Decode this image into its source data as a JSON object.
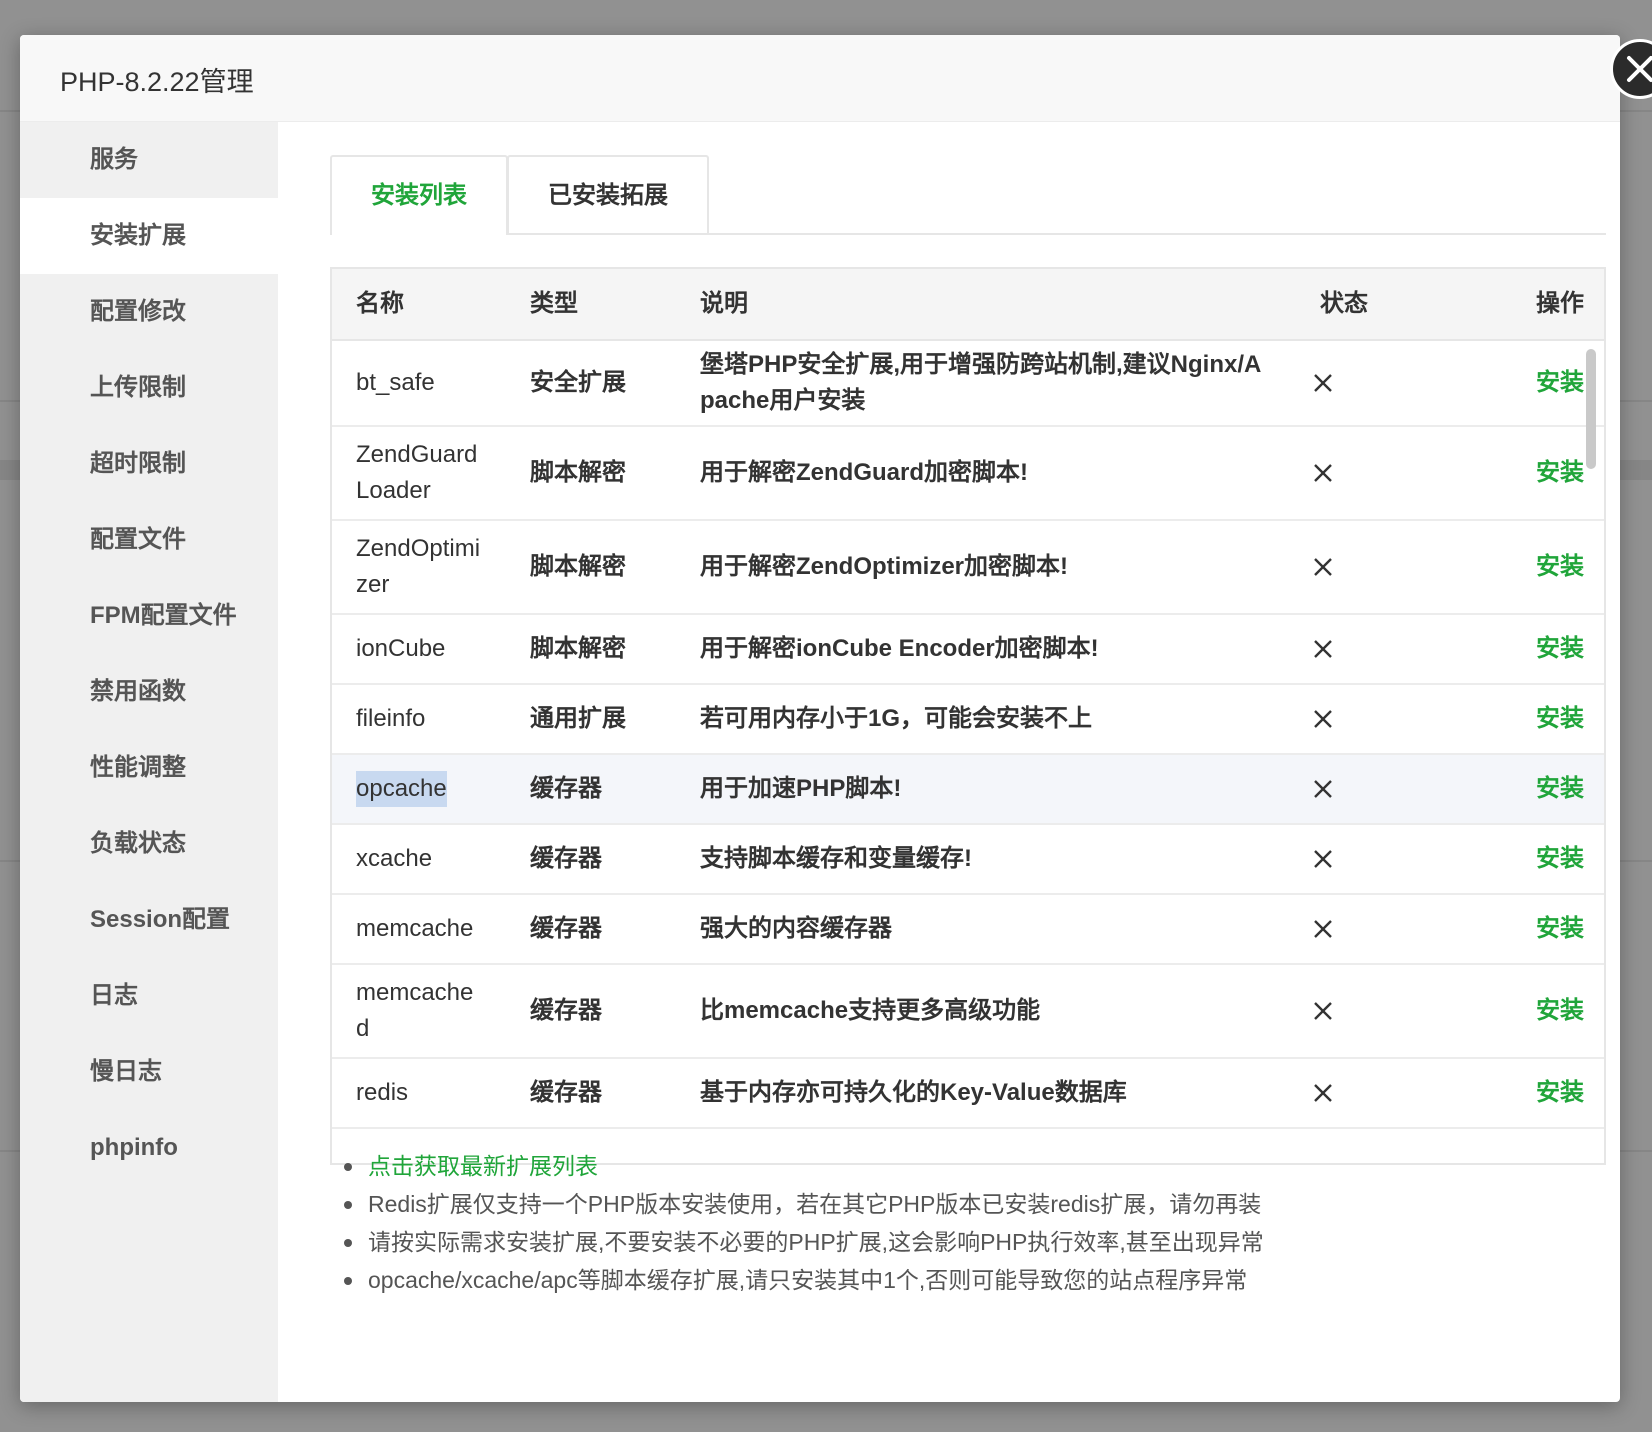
{
  "window": {
    "title": "PHP-8.2.22管理"
  },
  "close_icon": "close-circle-icon",
  "sidebar": {
    "items": [
      {
        "label": "服务",
        "active": false
      },
      {
        "label": "安装扩展",
        "active": true
      },
      {
        "label": "配置修改",
        "active": false
      },
      {
        "label": "上传限制",
        "active": false
      },
      {
        "label": "超时限制",
        "active": false
      },
      {
        "label": "配置文件",
        "active": false
      },
      {
        "label": "FPM配置文件",
        "active": false
      },
      {
        "label": "禁用函数",
        "active": false
      },
      {
        "label": "性能调整",
        "active": false
      },
      {
        "label": "负载状态",
        "active": false
      },
      {
        "label": "Session配置",
        "active": false
      },
      {
        "label": "日志",
        "active": false
      },
      {
        "label": "慢日志",
        "active": false
      },
      {
        "label": "phpinfo",
        "active": false
      }
    ]
  },
  "tabs": [
    {
      "label": "安装列表",
      "active": true
    },
    {
      "label": "已安装拓展",
      "active": false
    }
  ],
  "table": {
    "headers": {
      "name": "名称",
      "type": "类型",
      "desc": "说明",
      "status": "状态",
      "op": "操作"
    },
    "rows": [
      {
        "name": "bt_safe",
        "type": "安全扩展",
        "desc": "堡塔PHP安全扩展,用于增强防跨站机制,建议Nginx/Apache用户安装",
        "status": "✕",
        "op": "安装"
      },
      {
        "name": "ZendGuardLoader",
        "type": "脚本解密",
        "desc": "用于解密ZendGuard加密脚本!",
        "status": "✕",
        "op": "安装"
      },
      {
        "name": "ZendOptimizer",
        "type": "脚本解密",
        "desc": "用于解密ZendOptimizer加密脚本!",
        "status": "✕",
        "op": "安装"
      },
      {
        "name": "ionCube",
        "type": "脚本解密",
        "desc": "用于解密ionCube Encoder加密脚本!",
        "status": "✕",
        "op": "安装"
      },
      {
        "name": "fileinfo",
        "type": "通用扩展",
        "desc": "若可用内存小于1G，可能会安装不上",
        "status": "✕",
        "op": "安装"
      },
      {
        "name": "opcache",
        "type": "缓存器",
        "desc": "用于加速PHP脚本!",
        "status": "✕",
        "op": "安装"
      },
      {
        "name": "xcache",
        "type": "缓存器",
        "desc": "支持脚本缓存和变量缓存!",
        "status": "✕",
        "op": "安装"
      },
      {
        "name": "memcache",
        "type": "缓存器",
        "desc": "强大的内容缓存器",
        "status": "✕",
        "op": "安装"
      },
      {
        "name": "memcached",
        "type": "缓存器",
        "desc": "比memcache支持更多高级功能",
        "status": "✕",
        "op": "安装"
      },
      {
        "name": "redis",
        "type": "缓存器",
        "desc": "基于内存亦可持久化的Key-Value数据库",
        "status": "✕",
        "op": "安装"
      }
    ]
  },
  "notes": [
    {
      "text": "点击获取最新扩展列表",
      "link": true
    },
    {
      "text": "Redis扩展仅支持一个PHP版本安装使用，若在其它PHP版本已安装redis扩展，请勿再装",
      "link": false
    },
    {
      "text": "请按实际需求安装扩展,不要安装不必要的PHP扩展,这会影响PHP执行效率,甚至出现异常",
      "link": false
    },
    {
      "text": "opcache/xcache/apc等脚本缓存扩展,请只安装其中1个,否则可能导致您的站点程序异常",
      "link": false
    }
  ],
  "colors": {
    "accent": "#20a53a",
    "text": "#333333",
    "header_bg": "#f5f5f5"
  }
}
